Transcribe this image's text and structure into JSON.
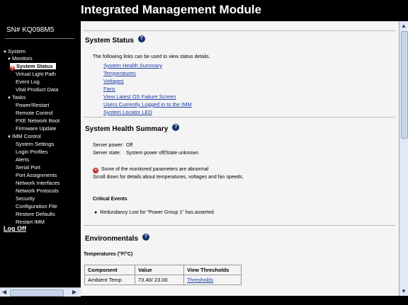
{
  "app_title": "Integrated Management Module",
  "serial": "SN# KQ098M5",
  "nav": {
    "system": "System",
    "monitors": "Monitors",
    "system_status": "System Status",
    "virtual_light_path": "Virtual Light Path",
    "event_log": "Event Log",
    "vital_product_data": "Vital Product Data",
    "tasks": "Tasks",
    "power_restart": "Power/Restart",
    "remote_control": "Remote Control",
    "pxe_network_boot": "PXE Network Boot",
    "firmware_update": "Firmware Update",
    "imm_control": "IMM Control",
    "system_settings": "System Settings",
    "login_profiles": "Login Profiles",
    "alerts": "Alerts",
    "serial_port": "Serial Port",
    "port_assignments": "Port Assignments",
    "network_interfaces": "Network Interfaces",
    "network_protocols": "Network Protocols",
    "security": "Security",
    "configuration_file": "Configuration File",
    "restore_defaults": "Restore Defaults",
    "restart_imm": "Restart IMM",
    "log_off": "Log Off"
  },
  "system_status": {
    "title": "System Status",
    "intro": "The following links can be used to view status details.",
    "links": [
      "System Health Summary",
      "Temperatures",
      "Voltages",
      "Fans",
      "View Latest OS Failure Screen",
      "Users Currently Logged in to the IMM",
      "System Locator LED"
    ]
  },
  "health": {
    "title": "System Health Summary",
    "server_power_label": "Server power:",
    "server_power_value": "Off",
    "server_state_label": "Server state:",
    "server_state_value": "System power off/State unknown",
    "warning": "Some of the monitored parameters are abnormal",
    "scroll_hint": "Scroll down for details about temperatures, voltages and fan speeds.",
    "critical_events_title": "Critical Events",
    "critical_events": [
      "Redundancy Lost for \"Power Group 1\" has asserted"
    ]
  },
  "environmentals": {
    "title": "Environmentals",
    "temps_title": "Temperatures (°F/°C)",
    "columns": [
      "Component",
      "Value",
      "View Thresholds"
    ],
    "rows": [
      {
        "component": "Ambient Temp",
        "value": "73.40/ 23.00",
        "thresholds": "Thresholds"
      }
    ]
  },
  "icons": {
    "help": "question-mark-icon",
    "error": "error-x-icon",
    "expand": "triangle-down-icon"
  },
  "colors": {
    "link": "#1a3fa6",
    "error": "#c62828",
    "help_badge": "#15306b"
  }
}
